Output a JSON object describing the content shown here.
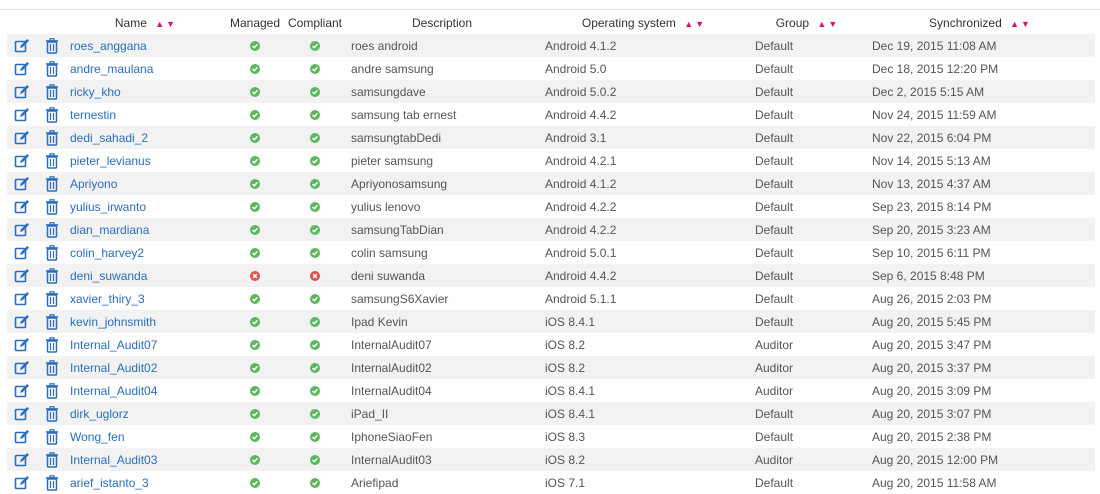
{
  "headers": {
    "name": "Name",
    "managed": "Managed",
    "compliant": "Compliant",
    "description": "Description",
    "os": "Operating system",
    "group": "Group",
    "synchronized": "Synchronized"
  },
  "sort_arrows": {
    "up": "▲",
    "down": "▼"
  },
  "colors": {
    "link": "#2a6ebb",
    "ok": "#5cb85c",
    "error": "#d9534f",
    "sort": "#d1157a",
    "action": "#2a6ebb"
  },
  "icons": {
    "edit": "edit-icon",
    "delete": "trash-icon",
    "ok": "check-circle-icon",
    "error": "x-circle-icon"
  },
  "rows": [
    {
      "name": "roes_anggana",
      "managed": "ok",
      "compliant": "ok",
      "description": "roes android",
      "os": "Android 4.1.2",
      "group": "Default",
      "synchronized": "Dec 19, 2015 11:08 AM"
    },
    {
      "name": "andre_maulana",
      "managed": "ok",
      "compliant": "ok",
      "description": "andre samsung",
      "os": "Android 5.0",
      "group": "Default",
      "synchronized": "Dec 18, 2015 12:20 PM"
    },
    {
      "name": "ricky_kho",
      "managed": "ok",
      "compliant": "ok",
      "description": "samsungdave",
      "os": "Android 5.0.2",
      "group": "Default",
      "synchronized": "Dec 2, 2015 5:15 AM"
    },
    {
      "name": "ternestin",
      "managed": "ok",
      "compliant": "ok",
      "description": "samsung tab ernest",
      "os": "Android 4.4.2",
      "group": "Default",
      "synchronized": "Nov 24, 2015 11:59 AM"
    },
    {
      "name": "dedi_sahadi_2",
      "managed": "ok",
      "compliant": "ok",
      "description": "samsungtabDedi",
      "os": "Android 3.1",
      "group": "Default",
      "synchronized": "Nov 22, 2015 6:04 PM"
    },
    {
      "name": "pieter_levianus",
      "managed": "ok",
      "compliant": "ok",
      "description": "pieter samsung",
      "os": "Android 4.2.1",
      "group": "Default",
      "synchronized": "Nov 14, 2015 5:13 AM"
    },
    {
      "name": "Apriyono",
      "managed": "ok",
      "compliant": "ok",
      "description": "Apriyonosamsung",
      "os": "Android 4.1.2",
      "group": "Default",
      "synchronized": "Nov 13, 2015 4:37 AM"
    },
    {
      "name": "yulius_irwanto",
      "managed": "ok",
      "compliant": "ok",
      "description": "yulius lenovo",
      "os": "Android 4.2.2",
      "group": "Default",
      "synchronized": "Sep 23, 2015 8:14 PM"
    },
    {
      "name": "dian_mardiana",
      "managed": "ok",
      "compliant": "ok",
      "description": "samsungTabDian",
      "os": "Android 4.2.2",
      "group": "Default",
      "synchronized": "Sep 20, 2015 3:23 AM"
    },
    {
      "name": "colin_harvey2",
      "managed": "ok",
      "compliant": "ok",
      "description": "colin samsung",
      "os": "Android 5.0.1",
      "group": "Default",
      "synchronized": "Sep 10, 2015 6:11 PM"
    },
    {
      "name": "deni_suwanda",
      "managed": "error",
      "compliant": "error",
      "description": "deni suwanda",
      "os": "Android 4.4.2",
      "group": "Default",
      "synchronized": "Sep 6, 2015 8:48 PM"
    },
    {
      "name": "xavier_thiry_3",
      "managed": "ok",
      "compliant": "ok",
      "description": "samsungS6Xavier",
      "os": "Android 5.1.1",
      "group": "Default",
      "synchronized": "Aug 26, 2015 2:03 PM"
    },
    {
      "name": "kevin_johnsmith",
      "managed": "ok",
      "compliant": "ok",
      "description": "Ipad Kevin",
      "os": "iOS 8.4.1",
      "group": "Default",
      "synchronized": "Aug 20, 2015 5:45 PM"
    },
    {
      "name": "Internal_Audit07",
      "managed": "ok",
      "compliant": "ok",
      "description": "InternalAudit07",
      "os": "iOS 8.2",
      "group": "Auditor",
      "synchronized": "Aug 20, 2015 3:47 PM"
    },
    {
      "name": "Internal_Audit02",
      "managed": "ok",
      "compliant": "ok",
      "description": "InternalAudit02",
      "os": "iOS 8.2",
      "group": "Auditor",
      "synchronized": "Aug 20, 2015 3:37 PM"
    },
    {
      "name": "Internal_Audit04",
      "managed": "ok",
      "compliant": "ok",
      "description": "InternalAudit04",
      "os": "iOS 8.4.1",
      "group": "Auditor",
      "synchronized": "Aug 20, 2015 3:09 PM"
    },
    {
      "name": "dirk_uglorz",
      "managed": "ok",
      "compliant": "ok",
      "description": "iPad_II",
      "os": "iOS 8.4.1",
      "group": "Default",
      "synchronized": "Aug 20, 2015 3:07 PM"
    },
    {
      "name": "Wong_fen",
      "managed": "ok",
      "compliant": "ok",
      "description": "IphoneSiaoFen",
      "os": "iOS 8.3",
      "group": "Default",
      "synchronized": "Aug 20, 2015 2:38 PM"
    },
    {
      "name": "Internal_Audit03",
      "managed": "ok",
      "compliant": "ok",
      "description": "InternalAudit03",
      "os": "iOS 8.2",
      "group": "Auditor",
      "synchronized": "Aug 20, 2015 12:00 PM"
    },
    {
      "name": "arief_istanto_3",
      "managed": "ok",
      "compliant": "ok",
      "description": "Ariefipad",
      "os": "iOS 7.1",
      "group": "Default",
      "synchronized": "Aug 20, 2015 11:58 AM"
    }
  ]
}
